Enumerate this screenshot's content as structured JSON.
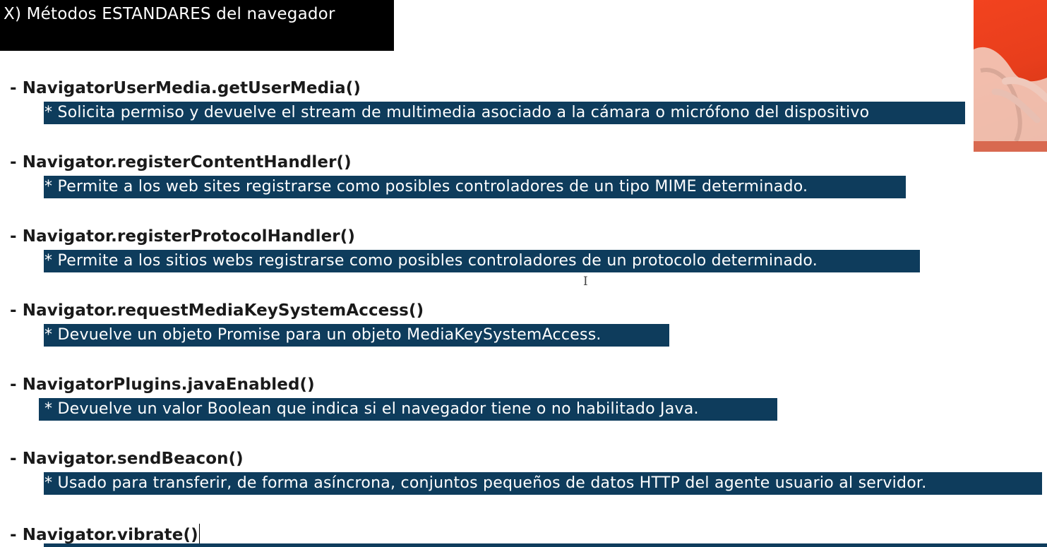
{
  "title": "X) Métodos ESTANDARES del navegador",
  "entries": [
    {
      "method": "- NavigatorUserMedia.getUserMedia()",
      "description": "* Solicita permiso y devuelve el stream de multimedia asociado a la cámara o micrófono del dispositivo"
    },
    {
      "method": "- Navigator.registerContentHandler()",
      "description": "* Permite a los web sites registrarse como posibles controladores de un tipo MIME determinado."
    },
    {
      "method": "- Navigator.registerProtocolHandler()",
      "description": "* Permite a los sitios webs registrarse como posibles controladores de un protocolo determinado."
    },
    {
      "method": "- Navigator.requestMediaKeySystemAccess()",
      "description": "* Devuelve un objeto Promise para un objeto MediaKeySystemAccess."
    },
    {
      "method": "- NavigatorPlugins.javaEnabled()",
      "description": "* Devuelve un valor Boolean que indica si el navegador tiene o no habilitado Java."
    },
    {
      "method": "- Navigator.sendBeacon()",
      "description": "* Usado para transferir, de forma asíncrona, conjuntos pequeños de datos HTTP del agente usuario al servidor."
    },
    {
      "method": "- Navigator.vibrate()",
      "description": ""
    }
  ],
  "colors": {
    "title_background": "#000000",
    "selection_highlight": "#0e3c5c",
    "webcam_background": "#e83e1c"
  },
  "icons": {
    "cursor": "text-ibeam-icon"
  }
}
